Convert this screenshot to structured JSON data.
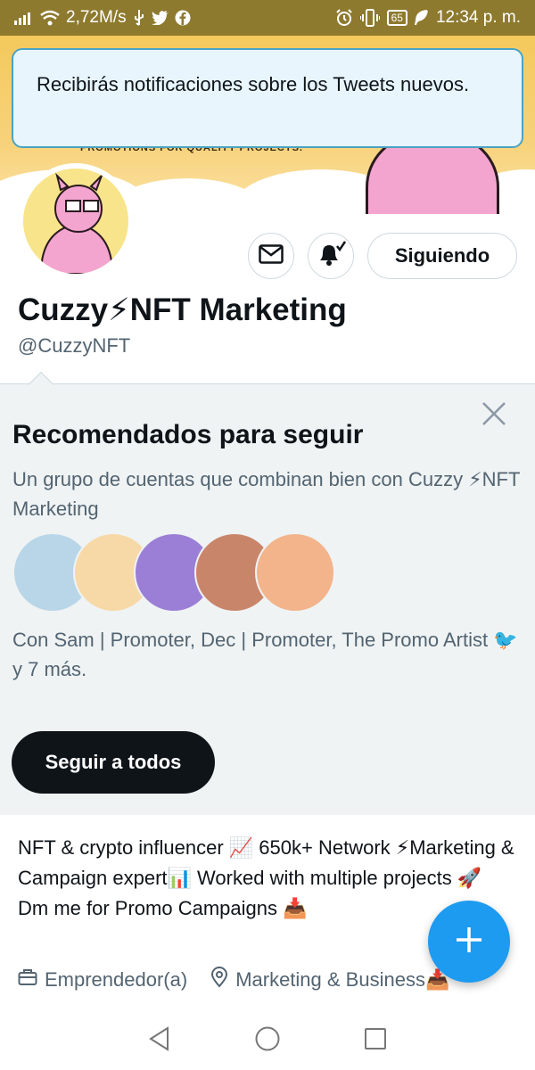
{
  "status_bar": {
    "network_speed": "2,72M/s",
    "battery": "65",
    "time": "12:34 p. m.",
    "icons": [
      "signal-icon",
      "wifi-icon",
      "usb-icon",
      "twitter-icon",
      "facebook-icon",
      "alarm-icon",
      "vibrate-icon",
      "battery-icon",
      "leaf-icon"
    ]
  },
  "toast": {
    "message": "Recibirás notificaciones sobre los Tweets nuevos."
  },
  "banner": {
    "text": "PROMOTIONS FOR QUALITY PROJECTS."
  },
  "profile": {
    "name": "Cuzzy⚡NFT Marketing",
    "handle": "@CuzzyNFT",
    "following_label": "Siguiendo",
    "bio": "NFT & crypto influencer 📈 650k+ Network ⚡Marketing & Campaign expert📊 Worked with multiple projects 🚀 Dm me for Promo Campaigns 📥",
    "occupation": "Emprendedor(a)",
    "location": "Marketing & Business📥"
  },
  "recommendations": {
    "title": "Recomendados para seguir",
    "subtitle": "Un grupo de cuentas que combinan bien con Cuzzy ⚡NFT Marketing",
    "with_text": "Con Sam | Promoter, Dec | Promoter, The Promo Artist 🐦 y 7 más.",
    "follow_all_label": "Seguir a todos",
    "avatar_colors": [
      "#b9d6e8",
      "#f7d9a8",
      "#9b7fd6",
      "#c9856a",
      "#f3b48b"
    ]
  },
  "colors": {
    "accent": "#1d9bf0",
    "dark": "#0f1419",
    "secondary_text": "#536471",
    "toast_border": "#4aa3c4",
    "status_bar": "#8e7a2e"
  }
}
